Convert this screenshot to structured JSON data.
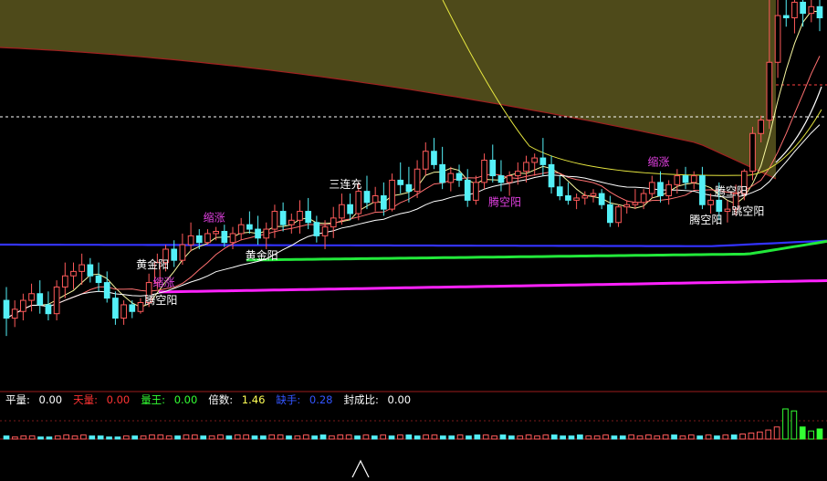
{
  "chart_data": [
    {
      "type": "candlestick",
      "title": "",
      "colors": {
        "background": "#000000",
        "up": "#ff5a5a",
        "down": "#54f0f7",
        "shade": "#4e4a1a",
        "ma_bright": "#22e83a",
        "ma_blue": "#3333ff",
        "ma_pink": "#ff22ff"
      },
      "price_range": [
        0,
        420
      ],
      "candles": [
        {
          "o": 150,
          "h": 162,
          "l": 118,
          "c": 134
        },
        {
          "o": 134,
          "h": 150,
          "l": 126,
          "c": 142
        },
        {
          "o": 140,
          "h": 156,
          "l": 132,
          "c": 150
        },
        {
          "o": 150,
          "h": 165,
          "l": 140,
          "c": 156
        },
        {
          "o": 156,
          "h": 168,
          "l": 138,
          "c": 146
        },
        {
          "o": 146,
          "h": 158,
          "l": 132,
          "c": 138
        },
        {
          "o": 138,
          "h": 168,
          "l": 132,
          "c": 162
        },
        {
          "o": 162,
          "h": 184,
          "l": 152,
          "c": 172
        },
        {
          "o": 172,
          "h": 184,
          "l": 160,
          "c": 176
        },
        {
          "o": 176,
          "h": 192,
          "l": 164,
          "c": 182
        },
        {
          "o": 182,
          "h": 188,
          "l": 166,
          "c": 172
        },
        {
          "o": 172,
          "h": 184,
          "l": 158,
          "c": 166
        },
        {
          "o": 166,
          "h": 176,
          "l": 148,
          "c": 152
        },
        {
          "o": 152,
          "h": 158,
          "l": 128,
          "c": 134
        },
        {
          "o": 134,
          "h": 150,
          "l": 128,
          "c": 146
        },
        {
          "o": 146,
          "h": 150,
          "l": 134,
          "c": 140
        },
        {
          "o": 140,
          "h": 152,
          "l": 138,
          "c": 148
        },
        {
          "o": 148,
          "h": 174,
          "l": 144,
          "c": 166
        },
        {
          "o": 166,
          "h": 192,
          "l": 160,
          "c": 184
        },
        {
          "o": 184,
          "h": 200,
          "l": 176,
          "c": 196
        },
        {
          "o": 196,
          "h": 204,
          "l": 180,
          "c": 186
        },
        {
          "o": 186,
          "h": 210,
          "l": 182,
          "c": 200
        },
        {
          "o": 200,
          "h": 220,
          "l": 194,
          "c": 208
        },
        {
          "o": 208,
          "h": 214,
          "l": 196,
          "c": 202
        },
        {
          "o": 202,
          "h": 214,
          "l": 200,
          "c": 210
        },
        {
          "o": 210,
          "h": 216,
          "l": 204,
          "c": 212
        },
        {
          "o": 212,
          "h": 218,
          "l": 198,
          "c": 202
        },
        {
          "o": 202,
          "h": 216,
          "l": 196,
          "c": 210
        },
        {
          "o": 210,
          "h": 224,
          "l": 204,
          "c": 218
        },
        {
          "o": 218,
          "h": 230,
          "l": 210,
          "c": 214
        },
        {
          "o": 214,
          "h": 226,
          "l": 200,
          "c": 206
        },
        {
          "o": 206,
          "h": 220,
          "l": 196,
          "c": 214
        },
        {
          "o": 214,
          "h": 236,
          "l": 206,
          "c": 230
        },
        {
          "o": 230,
          "h": 238,
          "l": 212,
          "c": 218
        },
        {
          "o": 218,
          "h": 228,
          "l": 210,
          "c": 222
        },
        {
          "o": 222,
          "h": 240,
          "l": 210,
          "c": 230
        },
        {
          "o": 230,
          "h": 242,
          "l": 214,
          "c": 220
        },
        {
          "o": 220,
          "h": 226,
          "l": 202,
          "c": 208
        },
        {
          "o": 208,
          "h": 222,
          "l": 196,
          "c": 216
        },
        {
          "o": 216,
          "h": 234,
          "l": 206,
          "c": 224
        },
        {
          "o": 224,
          "h": 246,
          "l": 218,
          "c": 236
        },
        {
          "o": 236,
          "h": 246,
          "l": 222,
          "c": 228
        },
        {
          "o": 228,
          "h": 256,
          "l": 222,
          "c": 248
        },
        {
          "o": 248,
          "h": 262,
          "l": 232,
          "c": 238
        },
        {
          "o": 238,
          "h": 252,
          "l": 230,
          "c": 244
        },
        {
          "o": 244,
          "h": 256,
          "l": 226,
          "c": 232
        },
        {
          "o": 232,
          "h": 264,
          "l": 230,
          "c": 258
        },
        {
          "o": 258,
          "h": 274,
          "l": 246,
          "c": 254
        },
        {
          "o": 254,
          "h": 270,
          "l": 238,
          "c": 248
        },
        {
          "o": 248,
          "h": 276,
          "l": 242,
          "c": 268
        },
        {
          "o": 268,
          "h": 292,
          "l": 262,
          "c": 284
        },
        {
          "o": 284,
          "h": 296,
          "l": 268,
          "c": 272
        },
        {
          "o": 272,
          "h": 288,
          "l": 250,
          "c": 256
        },
        {
          "o": 256,
          "h": 270,
          "l": 248,
          "c": 264
        },
        {
          "o": 264,
          "h": 272,
          "l": 252,
          "c": 258
        },
        {
          "o": 258,
          "h": 268,
          "l": 234,
          "c": 240
        },
        {
          "o": 240,
          "h": 262,
          "l": 236,
          "c": 256
        },
        {
          "o": 256,
          "h": 282,
          "l": 250,
          "c": 276
        },
        {
          "o": 276,
          "h": 290,
          "l": 256,
          "c": 262
        },
        {
          "o": 262,
          "h": 276,
          "l": 248,
          "c": 256
        },
        {
          "o": 256,
          "h": 266,
          "l": 244,
          "c": 262
        },
        {
          "o": 262,
          "h": 274,
          "l": 254,
          "c": 266
        },
        {
          "o": 266,
          "h": 280,
          "l": 256,
          "c": 274
        },
        {
          "o": 274,
          "h": 282,
          "l": 262,
          "c": 278
        },
        {
          "o": 278,
          "h": 296,
          "l": 262,
          "c": 272
        },
        {
          "o": 272,
          "h": 280,
          "l": 246,
          "c": 252
        },
        {
          "o": 252,
          "h": 262,
          "l": 240,
          "c": 244
        },
        {
          "o": 244,
          "h": 256,
          "l": 236,
          "c": 240
        },
        {
          "o": 240,
          "h": 246,
          "l": 232,
          "c": 242
        },
        {
          "o": 242,
          "h": 248,
          "l": 236,
          "c": 244
        },
        {
          "o": 244,
          "h": 250,
          "l": 238,
          "c": 246
        },
        {
          "o": 246,
          "h": 250,
          "l": 232,
          "c": 236
        },
        {
          "o": 236,
          "h": 244,
          "l": 216,
          "c": 220
        },
        {
          "o": 220,
          "h": 236,
          "l": 216,
          "c": 234
        },
        {
          "o": 234,
          "h": 240,
          "l": 228,
          "c": 236
        },
        {
          "o": 236,
          "h": 250,
          "l": 232,
          "c": 238
        },
        {
          "o": 238,
          "h": 250,
          "l": 232,
          "c": 246
        },
        {
          "o": 246,
          "h": 262,
          "l": 242,
          "c": 256
        },
        {
          "o": 256,
          "h": 266,
          "l": 238,
          "c": 244
        },
        {
          "o": 244,
          "h": 258,
          "l": 236,
          "c": 254
        },
        {
          "o": 254,
          "h": 268,
          "l": 246,
          "c": 262
        },
        {
          "o": 262,
          "h": 270,
          "l": 250,
          "c": 256
        },
        {
          "o": 256,
          "h": 266,
          "l": 250,
          "c": 262
        },
        {
          "o": 262,
          "h": 270,
          "l": 232,
          "c": 236
        },
        {
          "o": 236,
          "h": 246,
          "l": 228,
          "c": 240
        },
        {
          "o": 240,
          "h": 256,
          "l": 222,
          "c": 230
        },
        {
          "o": 230,
          "h": 240,
          "l": 220,
          "c": 232
        },
        {
          "o": 232,
          "h": 254,
          "l": 226,
          "c": 246
        },
        {
          "o": 246,
          "h": 268,
          "l": 240,
          "c": 266
        },
        {
          "o": 266,
          "h": 306,
          "l": 258,
          "c": 300
        },
        {
          "o": 300,
          "h": 316,
          "l": 292,
          "c": 312
        },
        {
          "o": 312,
          "h": 420,
          "l": 304,
          "c": 364
        },
        {
          "o": 364,
          "h": 420,
          "l": 350,
          "c": 406
        },
        {
          "o": 406,
          "h": 420,
          "l": 396,
          "c": 404
        },
        {
          "o": 404,
          "h": 420,
          "l": 390,
          "c": 418
        },
        {
          "o": 418,
          "h": 420,
          "l": 396,
          "c": 408
        },
        {
          "o": 408,
          "h": 420,
          "l": 400,
          "c": 414
        },
        {
          "o": 414,
          "h": 420,
          "l": 392,
          "c": 404
        }
      ],
      "signals": [
        {
          "text": "腾空阳",
          "color": "#ffffff",
          "i": 18
        },
        {
          "text": "黄金阳",
          "color": "#ffffff",
          "i": 17
        },
        {
          "text": "缩涨",
          "color": "#e040e0",
          "i": 19
        },
        {
          "text": "缩涨",
          "color": "#e040e0",
          "i": 25
        },
        {
          "text": "黄金阳",
          "color": "#ffffff",
          "i": 30
        },
        {
          "text": "三连充",
          "color": "#ffffff",
          "i": 40
        },
        {
          "text": "腾空阳",
          "color": "#e040e0",
          "i": 59
        },
        {
          "text": "缩涨",
          "color": "#e040e0",
          "i": 78
        },
        {
          "text": "腾空阳",
          "color": "#ffffff",
          "i": 83
        },
        {
          "text": "腾空阳",
          "color": "#ffffff",
          "i": 86
        },
        {
          "text": "跳空阳",
          "color": "#ffffff",
          "i": 88
        },
        {
          "text": "腾空阳",
          "color": "#ff3333",
          "i": 91
        }
      ]
    },
    {
      "type": "bar",
      "title": "",
      "legend": [
        {
          "label": "平量:",
          "value": "0.00",
          "label_color": "#ffffff",
          "value_color": "#ffffff"
        },
        {
          "label": "天量:",
          "value": "0.00",
          "label_color": "#ff3333",
          "value_color": "#ff3333"
        },
        {
          "label": "量王:",
          "value": "0.00",
          "label_color": "#33ff33",
          "value_color": "#33ff33"
        },
        {
          "label": "倍数:",
          "value": "1.46",
          "label_color": "#ffffff",
          "value_color": "#ffff55"
        },
        {
          "label": "缺手:",
          "value": "0.28",
          "label_color": "#3355ff",
          "value_color": "#3355ff"
        },
        {
          "label": "封成比:",
          "value": "0.00",
          "label_color": "#ffffff",
          "value_color": "#ffffff"
        }
      ],
      "values": [
        3,
        2,
        3,
        3,
        2,
        2,
        3,
        4,
        3,
        4,
        3,
        3,
        2,
        2,
        3,
        3,
        3,
        4,
        4,
        3,
        3,
        4,
        4,
        3,
        3,
        4,
        3,
        4,
        4,
        3,
        3,
        4,
        4,
        3,
        3,
        4,
        3,
        4,
        3,
        4,
        4,
        3,
        4,
        3,
        4,
        3,
        4,
        4,
        3,
        4,
        4,
        3,
        3,
        4,
        3,
        4,
        4,
        3,
        4,
        3,
        3,
        4,
        3,
        4,
        4,
        3,
        3,
        4,
        3,
        3,
        4,
        3,
        3,
        4,
        3,
        4,
        3,
        4,
        4,
        3,
        4,
        3,
        4,
        3,
        4,
        4,
        5,
        6,
        7,
        9,
        12,
        30,
        28,
        12,
        8,
        10
      ]
    }
  ]
}
